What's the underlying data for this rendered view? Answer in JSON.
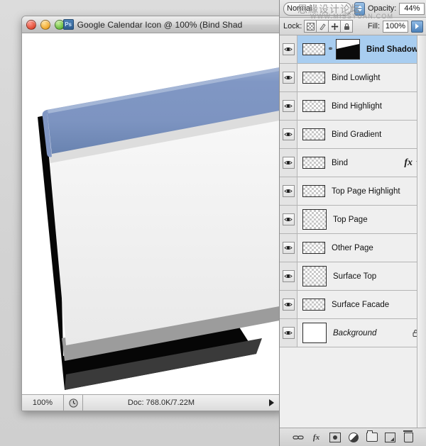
{
  "window": {
    "title": "Google Calendar Icon @ 100% (Bind Shad",
    "app_badge": "Ps",
    "traffic_lights": [
      "close-button",
      "minimize-button",
      "zoom-button"
    ]
  },
  "statusbar": {
    "zoom": "100%",
    "clock_icon": "clock-icon",
    "doc_info": "Doc: 768.0K/7.22M",
    "arrow_icon": "play-arrow-icon"
  },
  "panel": {
    "blend_mode": "Normal",
    "opacity_label": "Opacity:",
    "opacity_value": "44%",
    "lock_label": "Lock:",
    "lock_buttons": [
      "lock-transparency-icon",
      "lock-image-icon",
      "lock-position-icon",
      "lock-all-icon"
    ],
    "fill_label": "Fill:",
    "fill_value": "100%",
    "layers": [
      {
        "name": "Bind Shadow",
        "selected": true,
        "bold": true,
        "italic": false,
        "has_mask": true,
        "linked": true,
        "fx": false,
        "locked": false,
        "visible": true,
        "thumb": "bind-strip"
      },
      {
        "name": "Bind Lowlight",
        "selected": false,
        "bold": false,
        "italic": false,
        "has_mask": false,
        "linked": false,
        "fx": false,
        "locked": false,
        "visible": true,
        "thumb": "bind-strip"
      },
      {
        "name": "Bind Highlight",
        "selected": false,
        "bold": false,
        "italic": false,
        "has_mask": false,
        "linked": false,
        "fx": false,
        "locked": false,
        "visible": true,
        "thumb": "bind-strip"
      },
      {
        "name": "Bind Gradient",
        "selected": false,
        "bold": false,
        "italic": false,
        "has_mask": false,
        "linked": false,
        "fx": false,
        "locked": false,
        "visible": true,
        "thumb": "bind-strip"
      },
      {
        "name": "Bind",
        "selected": false,
        "bold": false,
        "italic": false,
        "has_mask": false,
        "linked": false,
        "fx": true,
        "locked": false,
        "visible": true,
        "thumb": "bind-solid"
      },
      {
        "name": "Top Page Highlight",
        "selected": false,
        "bold": false,
        "italic": false,
        "has_mask": false,
        "linked": false,
        "fx": false,
        "locked": false,
        "visible": true,
        "thumb": "bind-strip"
      },
      {
        "name": "Top Page",
        "selected": false,
        "bold": false,
        "italic": false,
        "has_mask": false,
        "linked": false,
        "fx": false,
        "locked": false,
        "visible": true,
        "thumb": "page-square"
      },
      {
        "name": "Other Page",
        "selected": false,
        "bold": false,
        "italic": false,
        "has_mask": false,
        "linked": false,
        "fx": false,
        "locked": false,
        "visible": true,
        "thumb": "diagonal"
      },
      {
        "name": "Surface Top",
        "selected": false,
        "bold": false,
        "italic": false,
        "has_mask": false,
        "linked": false,
        "fx": false,
        "locked": false,
        "visible": true,
        "thumb": "black-square"
      },
      {
        "name": "Surface Facade",
        "selected": false,
        "bold": false,
        "italic": false,
        "has_mask": false,
        "linked": false,
        "fx": false,
        "locked": false,
        "visible": true,
        "thumb": "diagonal-dark"
      },
      {
        "name": "Background",
        "selected": false,
        "bold": false,
        "italic": true,
        "has_mask": false,
        "linked": false,
        "fx": false,
        "locked": true,
        "visible": true,
        "thumb": "white"
      }
    ],
    "footer_icons": [
      "link-layers-icon",
      "layer-style-fx-icon",
      "add-mask-icon",
      "adjustment-layer-icon",
      "new-group-icon",
      "new-layer-icon",
      "delete-layer-icon"
    ]
  },
  "watermark": {
    "chinese": "思緣设计论坛",
    "english": "WWW.MISSYUAN.COM"
  },
  "artwork": {
    "description": "tilted calendar icon",
    "bind_color_light": "#8fa4cb",
    "bind_color_dark": "#5f7cae",
    "page_color": "#f0f0f0",
    "shadow_color": "#050505",
    "stack_gray": "#9a9a9a"
  }
}
